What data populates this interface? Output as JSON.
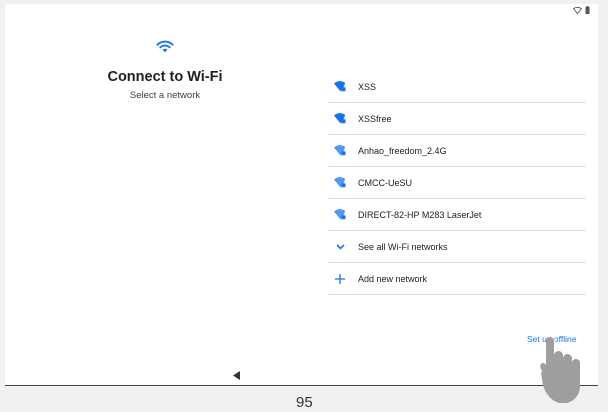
{
  "header": {
    "title": "Connect to Wi-Fi",
    "subtitle": "Select a network"
  },
  "networks": [
    {
      "label": "XSS",
      "icon": "wifi-locked-icon"
    },
    {
      "label": "XSSfree",
      "icon": "wifi-locked-icon"
    },
    {
      "label": "Anhao_freedom_2.4G",
      "icon": "wifi-locked-icon"
    },
    {
      "label": "CMCC-UeSU",
      "icon": "wifi-locked-icon"
    },
    {
      "label": "DIRECT-82-HP M283 LaserJet",
      "icon": "wifi-locked-icon"
    }
  ],
  "actions": {
    "see_all": "See all Wi-Fi networks",
    "add_network": "Add new network",
    "offline": "Set up offline"
  },
  "page_number": "95",
  "colors": {
    "accent": "#1a73e8",
    "text": "#202124",
    "divider": "#dadce0"
  }
}
